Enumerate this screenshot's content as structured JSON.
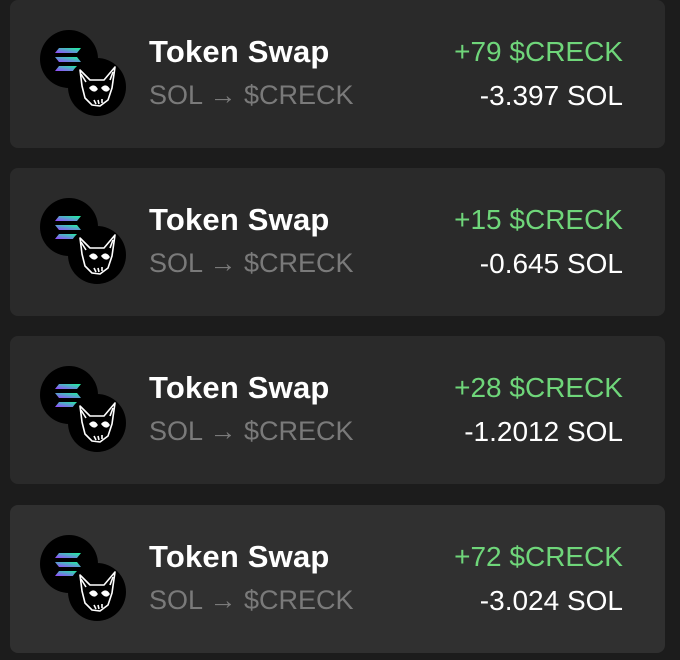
{
  "transactions": [
    {
      "title": "Token Swap",
      "subtitle": "SOL → $CRECK",
      "gain": "+79 $CRECK",
      "cost": "-3.397 SOL"
    },
    {
      "title": "Token Swap",
      "subtitle": "SOL → $CRECK",
      "gain": "+15 $CRECK",
      "cost": "-0.645 SOL"
    },
    {
      "title": "Token Swap",
      "subtitle": "SOL → $CRECK",
      "gain": "+28 $CRECK",
      "cost": "-1.2012 SOL"
    },
    {
      "title": "Token Swap",
      "subtitle": "SOL → $CRECK",
      "gain": "+72 $CRECK",
      "cost": "-3.024 SOL"
    }
  ],
  "icons": {
    "from": "solana-icon",
    "to": "creck-skull-icon"
  },
  "colors": {
    "gain": "#6fd67a",
    "card": "#2a2a2a",
    "background": "#1c1c1c"
  }
}
